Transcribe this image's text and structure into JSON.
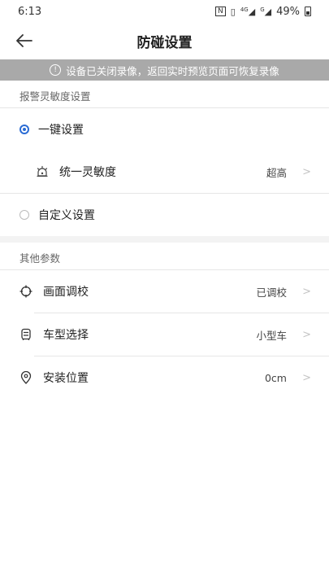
{
  "status_bar": {
    "time": "6:13",
    "nfc": "N",
    "vibrate": "▯",
    "network_4g": "4G",
    "network_g": "G",
    "battery": "49%"
  },
  "nav": {
    "title": "防碰设置"
  },
  "notice": {
    "text": "设备已关闭录像，返回实时预览页面可恢复录像"
  },
  "sensitivity_section": {
    "header": "报警灵敏度设置",
    "one_key": {
      "label": "一键设置",
      "checked": true
    },
    "unified": {
      "label": "统一灵敏度",
      "value": "超高"
    },
    "custom": {
      "label": "自定义设置",
      "checked": false
    }
  },
  "other_section": {
    "header": "其他参数",
    "items": [
      {
        "label": "画面调校",
        "value": "已调校",
        "icon": "crosshair-icon"
      },
      {
        "label": "车型选择",
        "value": "小型车",
        "icon": "car-icon"
      },
      {
        "label": "安装位置",
        "value": "0cm",
        "icon": "location-pin-icon"
      }
    ]
  },
  "chevron": ">",
  "accent_color": "#2b6cd4"
}
